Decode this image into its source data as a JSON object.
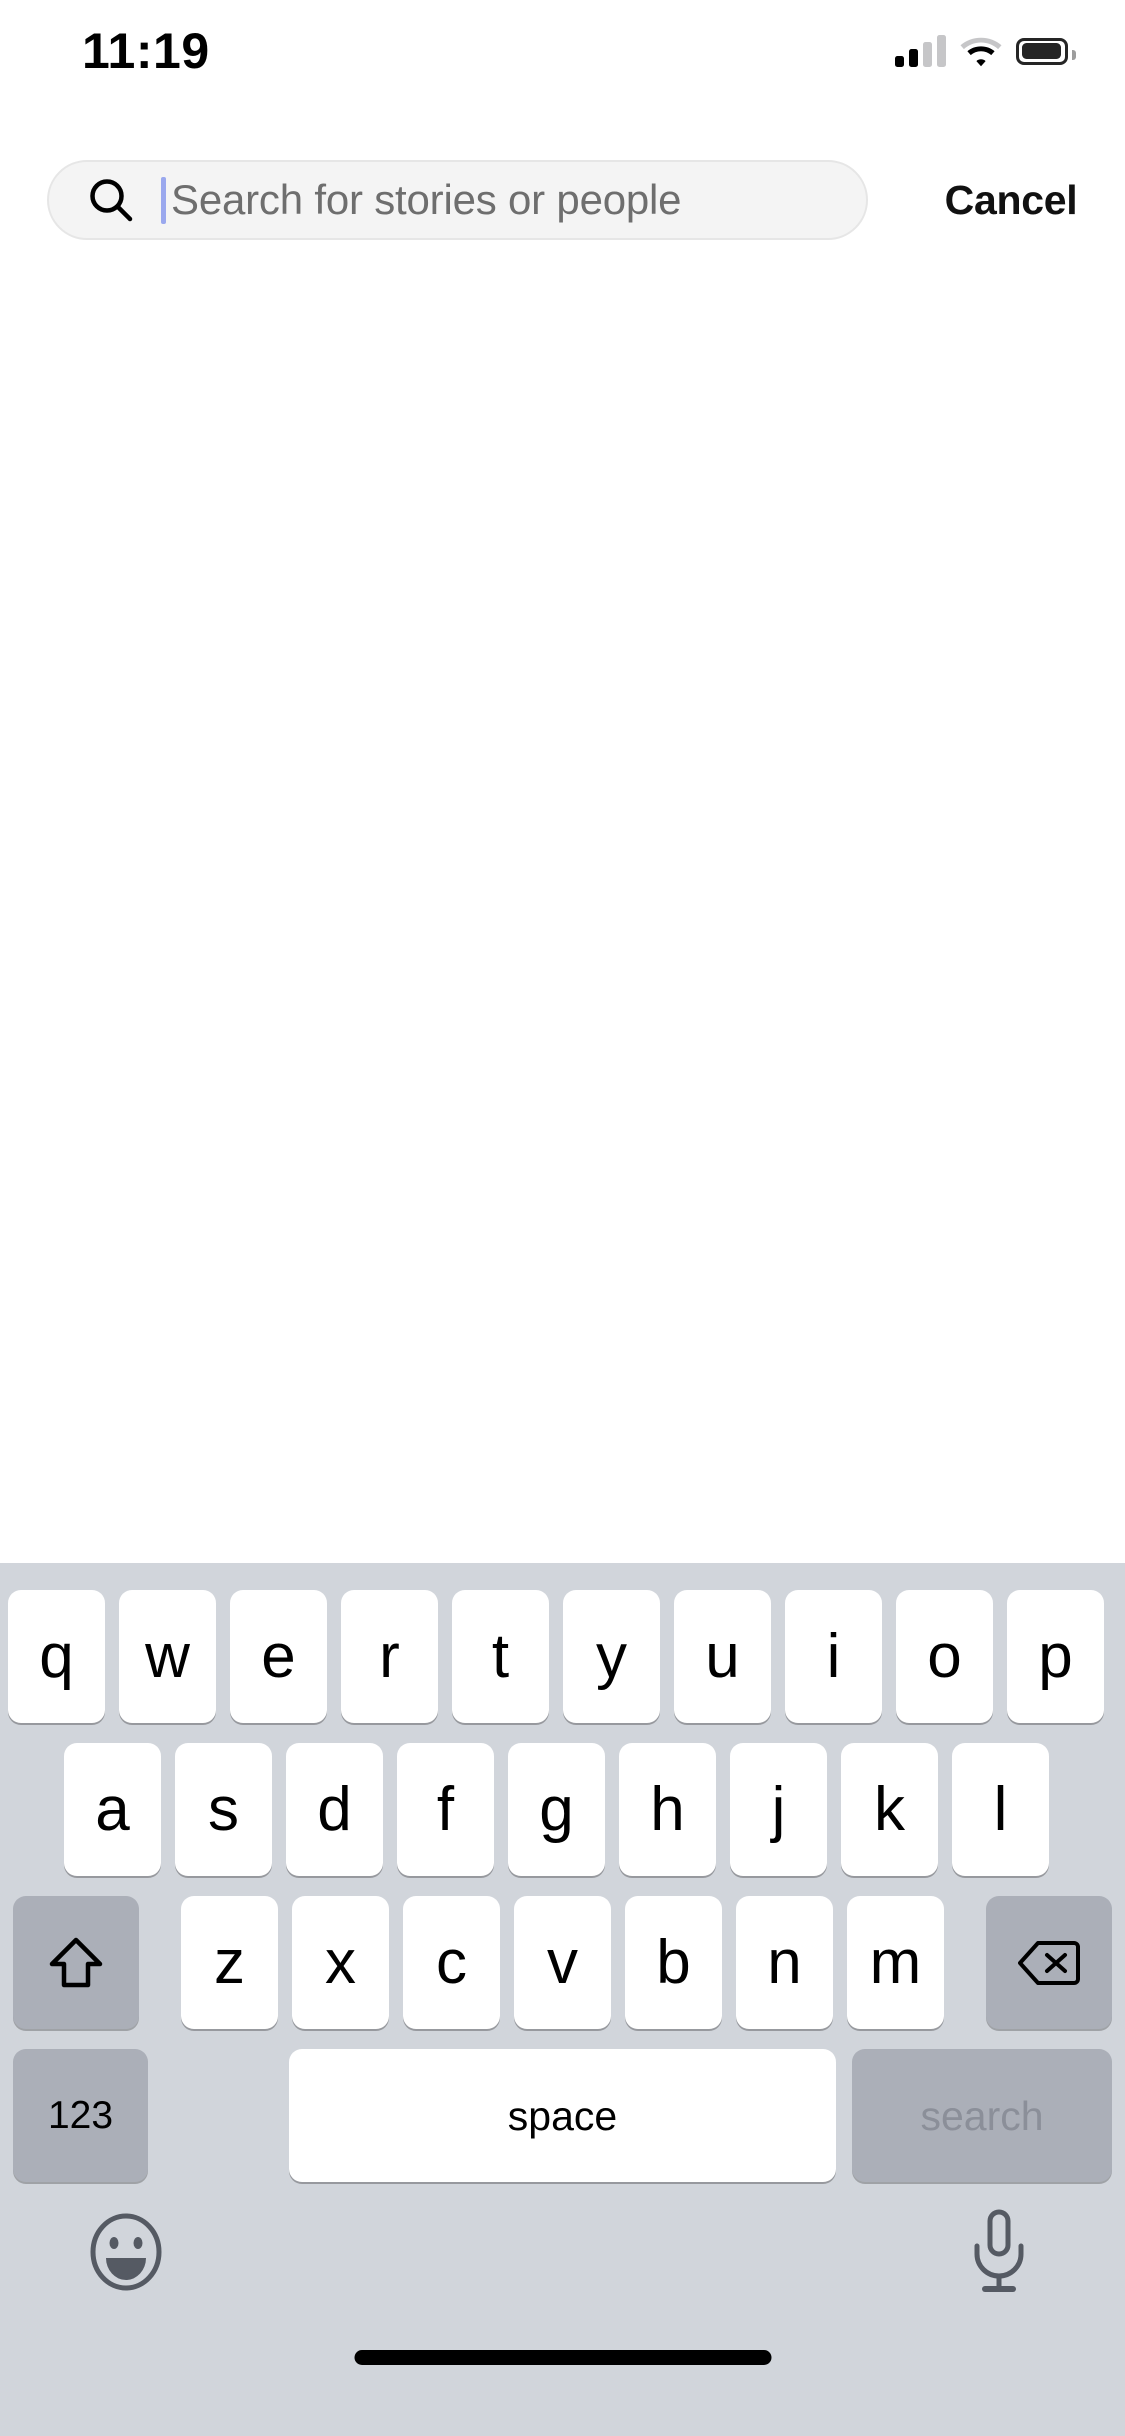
{
  "status_bar": {
    "time": "11:19",
    "cellular_icon": "cellular-signal-icon",
    "cellular_bars_filled": 2,
    "cellular_bars_total": 4,
    "wifi_icon": "wifi-icon",
    "battery_icon": "battery-icon",
    "battery_level_percent": 80
  },
  "search_header": {
    "search_icon": "search-icon",
    "placeholder": "Search for stories or people",
    "value": "",
    "caret_visible": true,
    "caret_color": "#9aa8ee",
    "cancel_label": "Cancel",
    "field_background": "#f4f4f4"
  },
  "content": {
    "results": [],
    "empty": true
  },
  "keyboard": {
    "background_color": "#d1d5db",
    "key_color": "#ffffff",
    "modifier_key_color": "#abafb8",
    "layout": "qwerty-lowercase",
    "row1": [
      "q",
      "w",
      "e",
      "r",
      "t",
      "y",
      "u",
      "i",
      "o",
      "p"
    ],
    "row2": [
      "a",
      "s",
      "d",
      "f",
      "g",
      "h",
      "j",
      "k",
      "l"
    ],
    "row3": [
      "z",
      "x",
      "c",
      "v",
      "b",
      "n",
      "m"
    ],
    "shift_key": {
      "name": "shift-key",
      "icon": "shift-arrow-up-icon",
      "label": ""
    },
    "delete_key": {
      "name": "delete-key",
      "icon": "backspace-delete-icon",
      "label": ""
    },
    "numbers_key": {
      "name": "numbers-key",
      "label": "123"
    },
    "space_key": {
      "name": "space-key",
      "label": "space"
    },
    "return_key": {
      "name": "search-return-key",
      "label": "search",
      "disabled": true,
      "text_color": "#8b8f99"
    },
    "emoji_key": {
      "name": "emoji-key",
      "icon": "smiley-face-icon"
    },
    "dictation_key": {
      "name": "dictation-key",
      "icon": "microphone-icon"
    }
  },
  "home_indicator": {
    "name": "home-indicator",
    "color": "#000000"
  }
}
